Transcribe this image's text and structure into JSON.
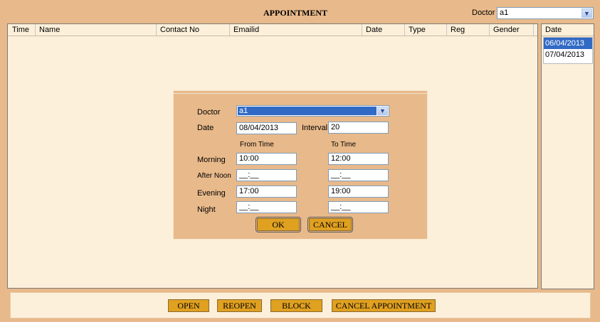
{
  "header": {
    "title": "APPOINTMENT",
    "doctor_label": "Doctor",
    "doctor_value": "a1"
  },
  "table": {
    "columns": [
      "Time",
      "Name",
      "Contact No",
      "Emailid",
      "Date",
      "Type",
      "Reg",
      "Gender"
    ]
  },
  "side": {
    "header": "Date",
    "dates": [
      "06/04/2013",
      "07/04/2013"
    ]
  },
  "dialog": {
    "doctor_label": "Doctor",
    "doctor_value": "a1",
    "date_label": "Date",
    "date_value": "08/04/2013",
    "interval_label": "Interval",
    "interval_value": "20",
    "from_time_label": "From Time",
    "to_time_label": "To Time",
    "rows": [
      {
        "label": "Morning",
        "from": "10:00",
        "to": "12:00"
      },
      {
        "label": "After Noon",
        "from": "__:__",
        "to": "__:__"
      },
      {
        "label": "Evening",
        "from": "17:00",
        "to": "19:00"
      },
      {
        "label": "Night",
        "from": "__:__",
        "to": "__:__"
      }
    ],
    "ok_label": "OK",
    "cancel_label": "CANCEL"
  },
  "footer": {
    "open": "OPEN",
    "reopen": "REOPEN",
    "block": "BLOCK",
    "cancel_appointment": "CANCEL APPOINTMENT"
  }
}
